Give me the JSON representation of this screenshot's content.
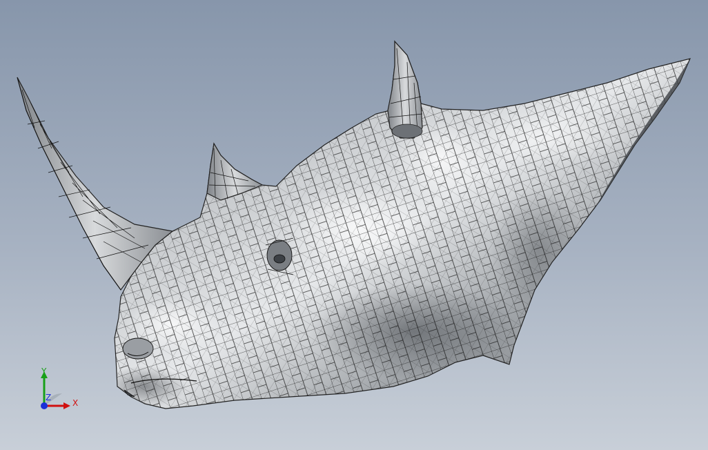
{
  "viewport": {
    "colors": {
      "background_top": "#8796ab",
      "background_bottom": "#c8cfd8",
      "model_surface": "#b4b8bc",
      "mesh_lines": "#111111"
    }
  },
  "model": {
    "name": "rhino-head-mesh",
    "display_mode": "shaded-with-edges"
  },
  "triad": {
    "x_label": "X",
    "y_label": "Y",
    "z_label": "Z",
    "colors": {
      "x": "#d01010",
      "y": "#18a018",
      "z": "#1a2fd8"
    }
  }
}
